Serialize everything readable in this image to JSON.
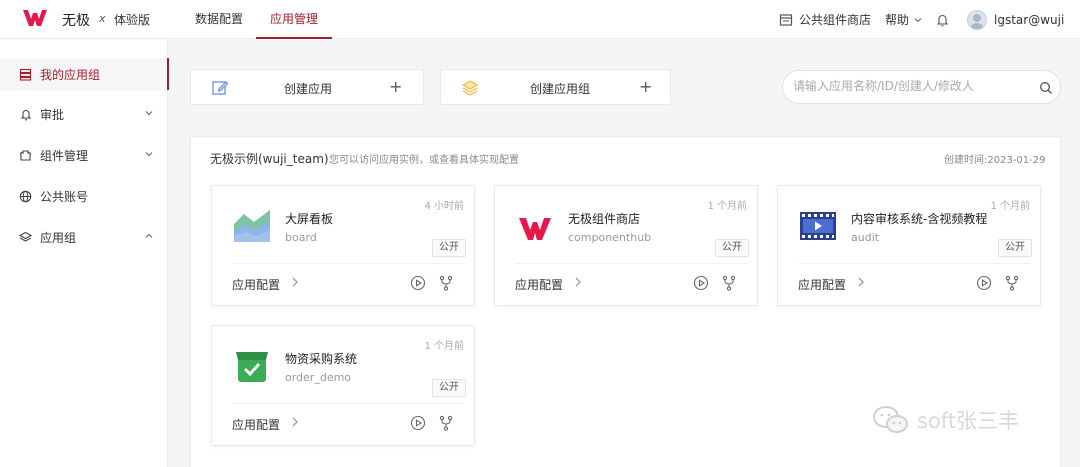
{
  "header": {
    "brand": "无极",
    "brand_x": "x",
    "edition": "体验版",
    "tabs": [
      {
        "label": "数据配置",
        "active": false
      },
      {
        "label": "应用管理",
        "active": true
      }
    ],
    "store_label": "公共组件商店",
    "help_label": "帮助",
    "user": "lgstar@wuji"
  },
  "sidebar": {
    "items": [
      {
        "label": "我的应用组",
        "icon": "stack-icon",
        "active": true
      },
      {
        "label": "审批",
        "icon": "bell-icon",
        "chevron": "down"
      },
      {
        "label": "组件管理",
        "icon": "component-icon",
        "chevron": "down"
      },
      {
        "label": "公共账号",
        "icon": "globe-icon"
      },
      {
        "label": "应用组",
        "icon": "layers-icon",
        "chevron": "up"
      }
    ]
  },
  "actions": {
    "create_app": "创建应用",
    "create_group": "创建应用组",
    "plus": "+"
  },
  "search": {
    "placeholder": "请输入应用名称/ID/创建人/修改人"
  },
  "group": {
    "title": "无极示例(wuji_team)",
    "desc": "您可以访问应用实例，或查看具体实现配置",
    "created": "创建时间:2023-01-29",
    "apps": [
      {
        "name": "大屏看板",
        "code": "board",
        "time": "4 小时前",
        "badge": "公开",
        "config_label": "应用配置",
        "icon": "area-chart-icon"
      },
      {
        "name": "无极组件商店",
        "code": "componenthub",
        "time": "1 个月前",
        "badge": "公开",
        "config_label": "应用配置",
        "icon": "wuji-logo-icon"
      },
      {
        "name": "内容审核系统-含视频教程",
        "code": "audit",
        "time": "1 个月前",
        "badge": "公开",
        "config_label": "应用配置",
        "icon": "video-film-icon"
      },
      {
        "name": "物资采购系统",
        "code": "order_demo",
        "time": "1 个月前",
        "badge": "公开",
        "config_label": "应用配置",
        "icon": "check-box-icon"
      }
    ]
  },
  "watermark": "soft张三丰",
  "colors": {
    "accent": "#a0202d",
    "logo": "#e8174b"
  }
}
